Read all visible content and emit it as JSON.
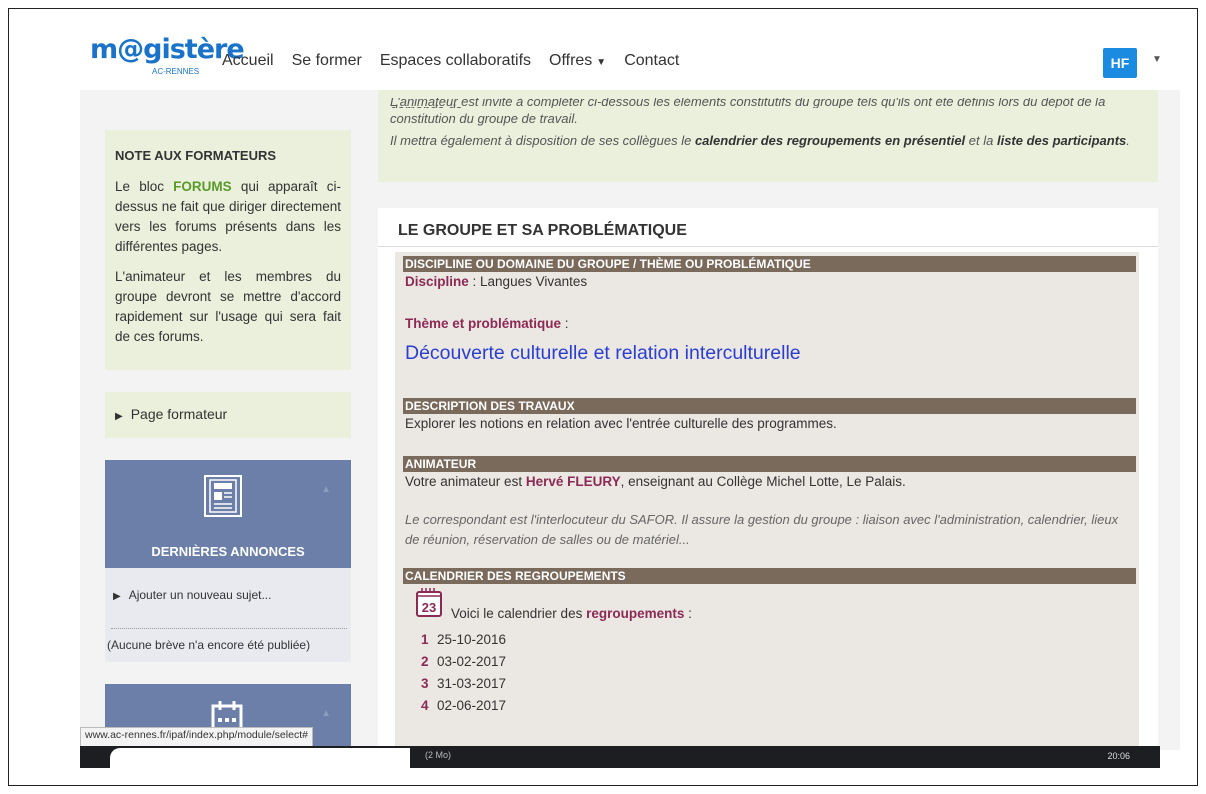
{
  "navbar": {
    "logo_main": "m@gistère",
    "logo_sub": "AC-RENNES",
    "links": [
      "Accueil",
      "Se former",
      "Espaces collaboratifs",
      "Offres",
      "Contact"
    ],
    "avatar": "HF"
  },
  "sidebar": {
    "note_title": "NOTE AUX FORMATEURS",
    "note_p1_prefix": "Le bloc ",
    "note_p1_highlight": "FORUMS",
    "note_p1_suffix": " qui apparaît ci-dessus ne fait que diriger directement vers les forums présents dans les différentes pages.",
    "note_p2": "L'animateur et les membres du groupe devront se mettre d'accord rapidement sur l'usage qui sera fait de ces forums.",
    "page_formateur": "Page formateur",
    "news_title": "DERNIÈRES ANNONCES",
    "news_add": "Ajouter un nouveau sujet...",
    "news_empty": "(Aucune brève n'a encore été publiée)"
  },
  "intro": {
    "cut_line": "L'animateur est invité à compléter ci-dessous les éléments constitutifs du groupe tels qu'ils ont été définis lors du dépôt de la demande de",
    "line1": "constitution du groupe de travail.",
    "line2_prefix": "Il mettra également à disposition de ses collègues le ",
    "line2_b1": "calendrier des regroupements en présentiel",
    "line2_mid": " et la ",
    "line2_b2": "liste des participants",
    "line2_end": "."
  },
  "main": {
    "group_title": "LE GROUPE ET SA PROBLÉMATIQUE",
    "sec1_title": "DISCIPLINE OU DOMAINE DU GROUPE / THÈME OU PROBLÉMATIQUE",
    "discipline_label": "Discipline",
    "discipline_value": " : Langues Vivantes",
    "theme_label": "Thème et problématique",
    "theme_colon": " :",
    "theme_value": "Découverte culturelle et relation interculturelle",
    "sec2_title": "DESCRIPTION DES TRAVAUX",
    "description": "Explorer les notions en relation avec l'entrée culturelle des programmes.",
    "sec3_title": "ANIMATEUR",
    "anim_prefix": "Votre animateur est ",
    "anim_name": "Hervé FLEURY",
    "anim_suffix": ", enseignant au Collège Michel Lotte, Le Palais.",
    "correspondant": "Le correspondant est l'interlocuteur du SAFOR. Il assure la gestion du groupe : liaison avec l'administration, calendrier, lieux de réunion, réservation de salles ou de matériel...",
    "sec4_title": "CALENDRIER DES REGROUPEMENTS",
    "cal_icon_day": "23",
    "cal_prefix": "Voici le calendrier des ",
    "cal_bold": "regroupements",
    "cal_suffix": " :",
    "dates": [
      {
        "num": "1",
        "date": "25-10-2016"
      },
      {
        "num": "2",
        "date": "03-02-2017"
      },
      {
        "num": "3",
        "date": "31-03-2017"
      },
      {
        "num": "4",
        "date": "02-06-2017"
      }
    ]
  },
  "status_url": "www.ac-rennes.fr/ipaf/index.php/module/select#",
  "taskbar": {
    "item1": "(2 Mo)",
    "clock": "20:06"
  },
  "colors": {
    "brand_blue": "#1a73c8",
    "section_bar": "#7a6a5c",
    "accent_purple": "#8b2a55",
    "theme_blue": "#2a3fcf",
    "note_green": "#eaf0dc",
    "news_header": "#6b7fa8"
  }
}
